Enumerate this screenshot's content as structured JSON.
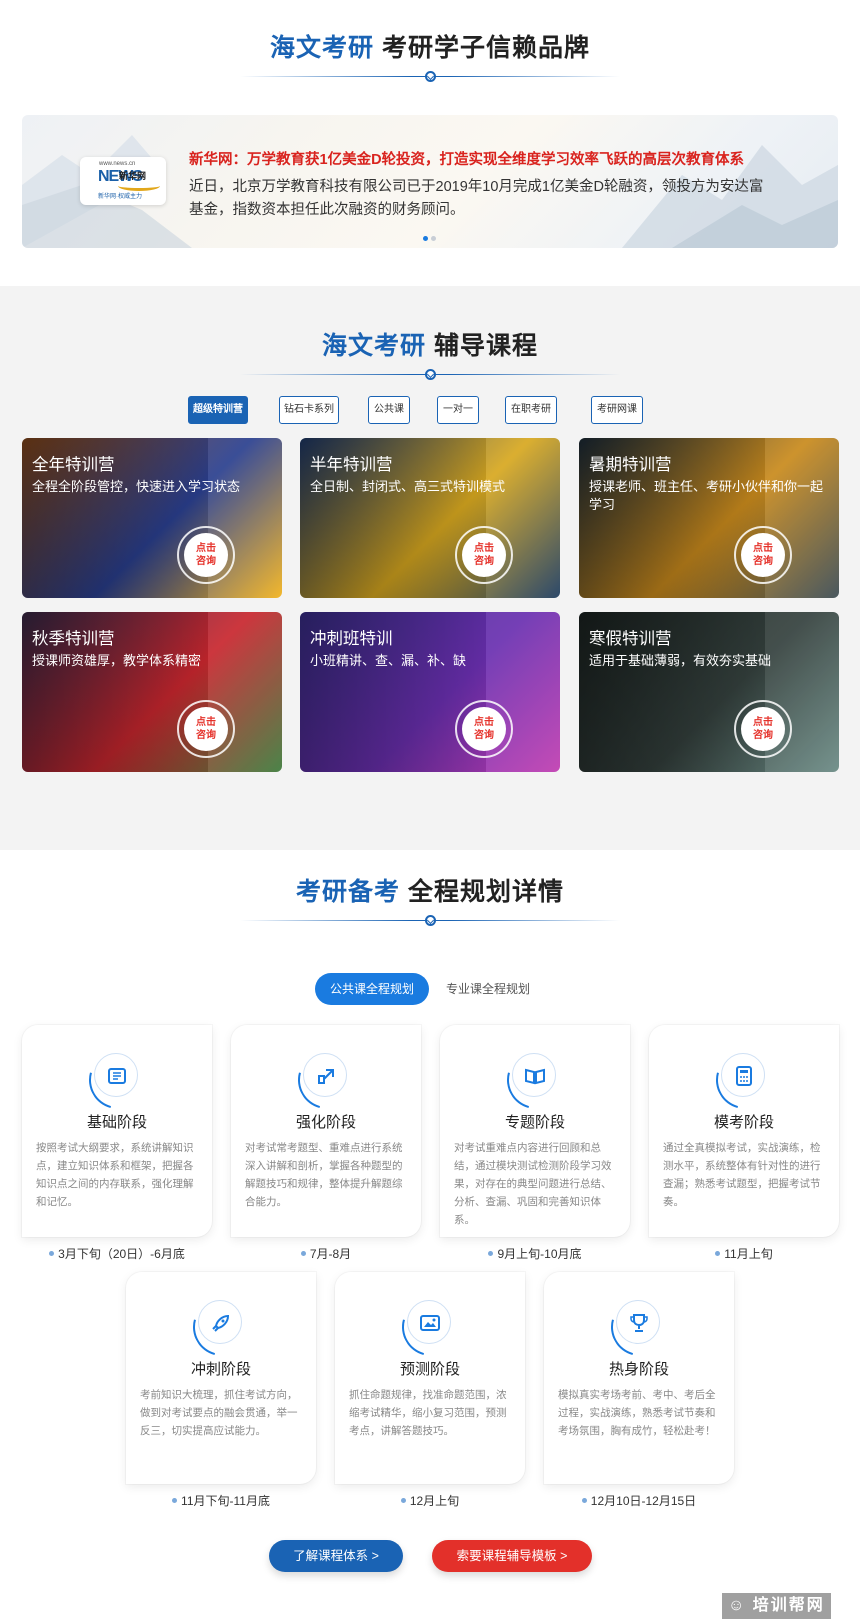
{
  "brand": {
    "title_accent": "海文考研",
    "title_rest": "考研学子信赖品牌"
  },
  "news": {
    "logo": {
      "domain": "www.news.cn",
      "mark": "NEWS",
      "cn": "新华网",
      "slogan": "新华网·权威主力"
    },
    "headline": "新华网：万学教育获1亿美金D轮投资，打造实现全维度学习效率飞跃的高层次教育体系",
    "body": "近日，北京万学教育科技有限公司已于2019年10月完成1亿美金D轮融资，领投方为安达富基金，指数资本担任此次融资的财务顾问。",
    "pager_count": 2,
    "pager_active": 0
  },
  "courses": {
    "title_accent": "海文考研",
    "title_rest": "辅导课程",
    "tabs": [
      {
        "label": "超级特训营",
        "active": true
      },
      {
        "label": "钻石卡系列",
        "active": false
      },
      {
        "label": "公共课",
        "active": false
      },
      {
        "label": "一对一",
        "active": false
      },
      {
        "label": "在职考研",
        "active": false
      },
      {
        "label": "考研网课",
        "active": false
      }
    ],
    "consult_line1": "点击",
    "consult_line2": "咨询",
    "items": [
      {
        "title": "全年特训营",
        "desc": "全程全阶段管控，快速进入学习状态",
        "colors": [
          "#8a4a1c",
          "#2a3f8f",
          "#f2b21b"
        ]
      },
      {
        "title": "半年特训营",
        "desc": "全日制、封闭式、高三式特训模式",
        "colors": [
          "#1f3b6e",
          "#d8a81f",
          "#1b3a5e"
        ]
      },
      {
        "title": "暑期特训营",
        "desc": "授课老师、班主任、考研小伙伴和你一起学习",
        "colors": [
          "#1d2d3a",
          "#c98a1c",
          "#3a4a52"
        ]
      },
      {
        "title": "秋季特训营",
        "desc": "授课师资雄厚，教学体系精密",
        "colors": [
          "#3a2a4a",
          "#c8262e",
          "#3c7a3a"
        ]
      },
      {
        "title": "冲刺班特训",
        "desc": "小班精讲、查、漏、补、缺",
        "colors": [
          "#3b2f8f",
          "#6a2fb0",
          "#c03cb0"
        ]
      },
      {
        "title": "寒假特训营",
        "desc": "适用于基础薄弱，有效夯实基础",
        "colors": [
          "#1c2422",
          "#34403d",
          "#6a8a84"
        ]
      }
    ]
  },
  "plan": {
    "title_accent": "考研备考",
    "title_rest": "全程规划详情",
    "tab_active": "公共课全程规划",
    "tab_other": "专业课全程规划",
    "stages": [
      {
        "name": "基础阶段",
        "icon": "book-icon",
        "desc": "按照考试大纲要求，系统讲解知识点，建立知识体系和框架，把握各知识点之间的内存联系，强化理解和记忆。",
        "date": "3月下旬（20日）-6月底"
      },
      {
        "name": "强化阶段",
        "icon": "upgrade-icon",
        "desc": "对考试常考题型、重难点进行系统深入讲解和剖析，掌握各种题型的解题技巧和规律，整体提升解题综合能力。",
        "date": "7月-8月"
      },
      {
        "name": "专题阶段",
        "icon": "open-book-icon",
        "desc": "对考试重难点内容进行回顾和总结，通过模块测试检测阶段学习效果，对存在的典型问题进行总结、分析、查漏、巩固和完善知识体系。",
        "date": "9月上旬-10月底"
      },
      {
        "name": "模考阶段",
        "icon": "calculator-icon",
        "desc": "通过全真模拟考试，实战演练，检测水平，系统整体有针对性的进行查漏；熟悉考试题型，把握考试节奏。",
        "date": "11月上旬"
      },
      {
        "name": "冲刺阶段",
        "icon": "rocket-icon",
        "desc": "考前知识大梳理，抓住考试方向，做到对考试要点的融会贯通，举一反三，切实提高应试能力。",
        "date": "11月下旬-11月底"
      },
      {
        "name": "预测阶段",
        "icon": "picture-icon",
        "desc": "抓住命题规律，找准命题范围，浓缩考试精华，缩小复习范围，预测考点，讲解答题技巧。",
        "date": "12月上旬"
      },
      {
        "name": "热身阶段",
        "icon": "trophy-icon",
        "desc": "模拟真实考场考前、考中、考后全过程，实战演练，熟悉考试节奏和考场氛围，胸有成竹，轻松赴考！",
        "date": "12月10日-12月15日"
      }
    ],
    "btn_system": "了解课程体系 >",
    "btn_template": "索要课程辅导模板 >"
  },
  "watermark": "培训帮网",
  "colors": {
    "primary": "#1a63b4",
    "accent_blue": "#1a7be0",
    "red": "#e3302a",
    "headline_red": "#d9231e"
  }
}
